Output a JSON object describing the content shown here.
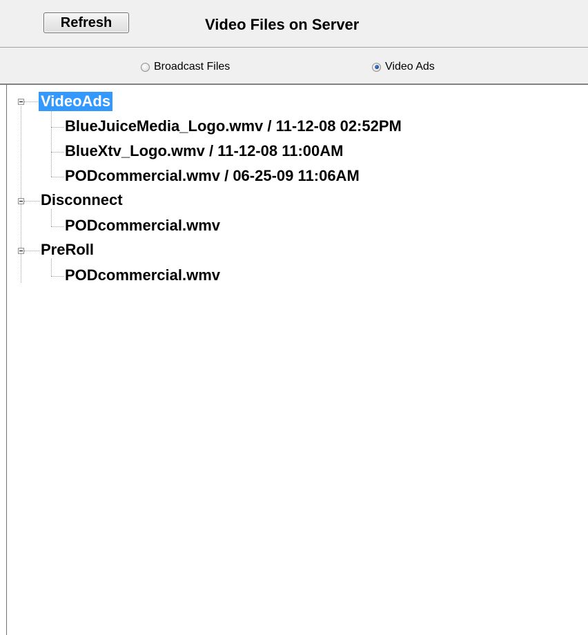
{
  "header": {
    "refresh_label": "Refresh",
    "title": "Video Files on Server"
  },
  "radio_bar": {
    "options": [
      {
        "label": "Broadcast Files",
        "checked": false
      },
      {
        "label": "Video Ads",
        "checked": true
      }
    ]
  },
  "tree": {
    "nodes": [
      {
        "label": "VideoAds",
        "selected": true,
        "expanded": true,
        "children": [
          {
            "label": "BlueJuiceMedia_Logo.wmv  /  11-12-08  02:52PM"
          },
          {
            "label": "BlueXtv_Logo.wmv  /  11-12-08  11:00AM"
          },
          {
            "label": "PODcommercial.wmv  /  06-25-09  11:06AM"
          }
        ]
      },
      {
        "label": "Disconnect",
        "selected": false,
        "expanded": true,
        "children": [
          {
            "label": "PODcommercial.wmv"
          }
        ]
      },
      {
        "label": "PreRoll",
        "selected": false,
        "expanded": true,
        "children": [
          {
            "label": "PODcommercial.wmv"
          }
        ]
      }
    ]
  },
  "colors": {
    "selection": "#3399ff",
    "toolbar_bg": "#f0f0f0"
  }
}
